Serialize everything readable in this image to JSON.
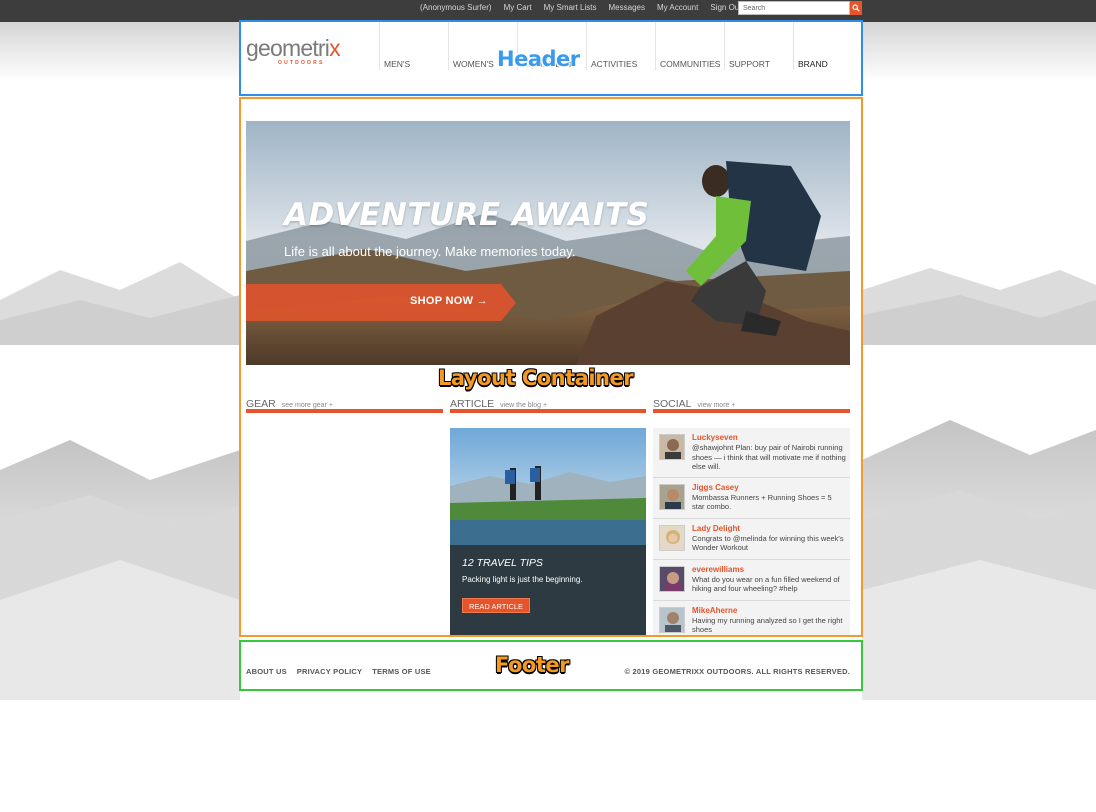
{
  "topbar": {
    "links": [
      "(Anonymous Surfer)",
      "My Cart",
      "My Smart Lists",
      "Messages",
      "My Account",
      "Sign Out"
    ],
    "search_placeholder": "Search"
  },
  "header": {
    "logo_main": "geometri",
    "logo_x": "x",
    "logo_sub": "OUTDOORS",
    "nav": [
      "MEN'S",
      "WOMEN'S",
      "EQUIPMENT",
      "ACTIVITIES",
      "COMMUNITIES",
      "SUPPORT",
      "BRAND"
    ]
  },
  "annotations": {
    "header": "Header",
    "layout": "Layout Container",
    "footer": "Footer"
  },
  "hero": {
    "title": "ADVENTURE AWAITS",
    "subtitle": "Life is all about the journey. Make memories today.",
    "cta": "SHOP NOW →"
  },
  "columns": {
    "gear": {
      "title": "GEAR",
      "more": "see more gear +"
    },
    "article": {
      "title": "ARTICLE",
      "more": "view the blog +"
    },
    "social": {
      "title": "SOCIAL",
      "more": "view more +"
    }
  },
  "article": {
    "title": "12 TRAVEL TIPS",
    "desc": "Packing light is just the beginning.",
    "button": "READ ARTICLE"
  },
  "social": [
    {
      "name": "Luckyseven",
      "text": "@shawjohnt Plan: buy pair of Nairobi running shoes — i think that will motivate me if nothing else will."
    },
    {
      "name": "Jiggs Casey",
      "text": "Mombassa Runners + Running Shoes = 5 star combo."
    },
    {
      "name": "Lady Delight",
      "text": "Congrats to @melinda for winning this week's Wonder Workout"
    },
    {
      "name": "everewilliams",
      "text": "What do you wear on a fun filled weekend of hiking and four wheeling? #help"
    },
    {
      "name": "MikeAherne",
      "text": "Having my running analyzed so I get the right shoes"
    }
  ],
  "footer": {
    "links": [
      "ABOUT US",
      "PRIVACY POLICY",
      "TERMS OF USE"
    ],
    "copyright": "© 2019 GEOMETRIXX OUTDOORS. ALL RIGHTS RESERVED."
  },
  "colors": {
    "accent": "#e5542a",
    "topbar": "#3d3d3d",
    "header_box": "#2f8ee8",
    "layout_box": "#f29a2e",
    "footer_box": "#36c93e"
  }
}
